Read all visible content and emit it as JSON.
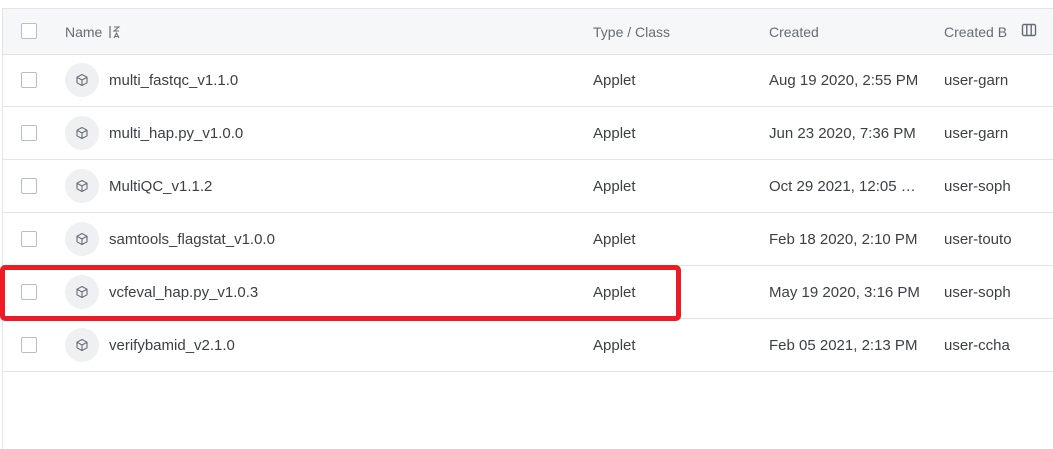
{
  "header": {
    "name_label": "Name",
    "type_label": "Type / Class",
    "created_label": "Created",
    "created_by_label": "Created B"
  },
  "rows": [
    {
      "name": "multi_fastqc_v1.1.0",
      "type": "Applet",
      "created": "Aug 19 2020, 2:55 PM",
      "created_by": "user-garn"
    },
    {
      "name": "multi_hap.py_v1.0.0",
      "type": "Applet",
      "created": "Jun 23 2020, 7:36 PM",
      "created_by": "user-garn"
    },
    {
      "name": "MultiQC_v1.1.2",
      "type": "Applet",
      "created": "Oct 29 2021, 12:05 …",
      "created_by": "user-soph"
    },
    {
      "name": "samtools_flagstat_v1.0.0",
      "type": "Applet",
      "created": "Feb 18 2020, 2:10 PM",
      "created_by": "user-touto"
    },
    {
      "name": "vcfeval_hap.py_v1.0.3",
      "type": "Applet",
      "created": "May 19 2020, 3:16 PM",
      "created_by": "user-soph"
    },
    {
      "name": "verifybamid_v2.1.0",
      "type": "Applet",
      "created": "Feb 05 2021, 2:13 PM",
      "created_by": "user-ccha"
    }
  ],
  "highlight_color": "#ec1c24",
  "row_icon": "cube-icon"
}
